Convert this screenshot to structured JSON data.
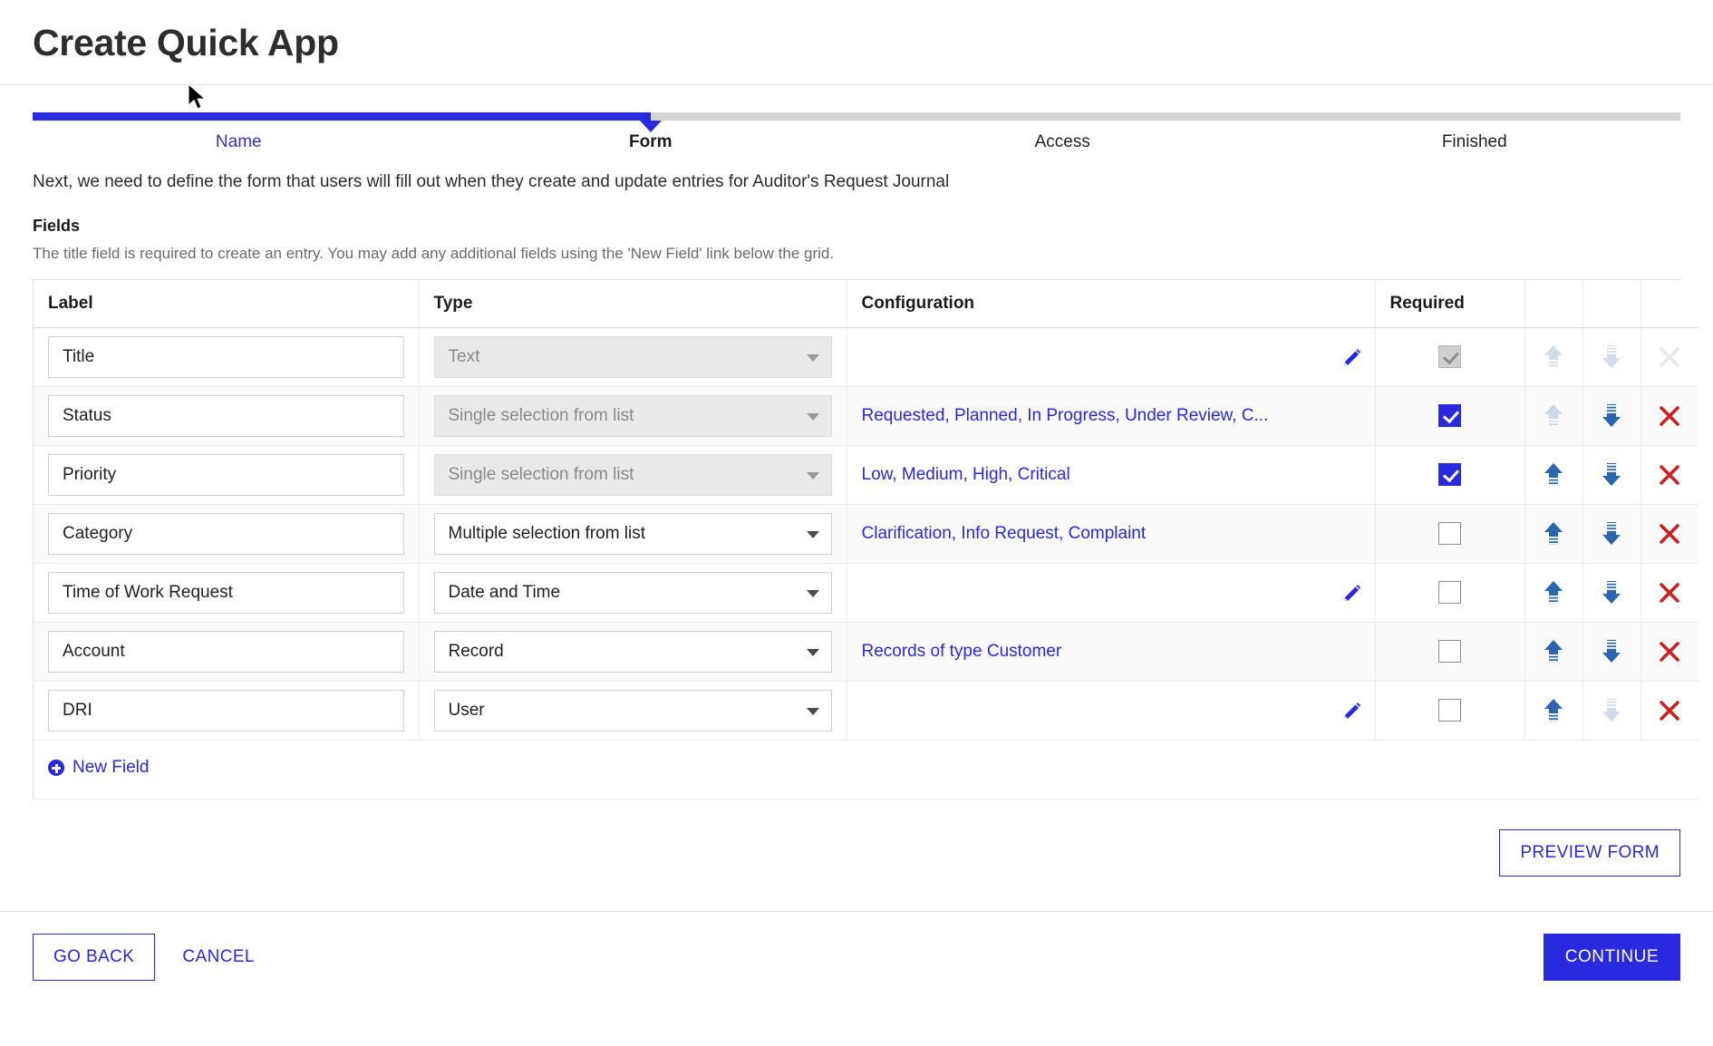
{
  "page": {
    "title": "Create Quick App",
    "intro": "Next, we need to define the form that users will fill out when they create and update entries for Auditor's Request Journal",
    "fields_heading": "Fields",
    "fields_subtext": "The title field is required to create an entry. You may add any additional fields using the 'New Field' link below the grid."
  },
  "stepper": {
    "fill_percent": 37.5,
    "accent_color": "#2929e0",
    "track_color": "#d4d4d4",
    "steps": [
      {
        "label": "Name",
        "state": "done"
      },
      {
        "label": "Form",
        "state": "current"
      },
      {
        "label": "Access",
        "state": "upcoming"
      },
      {
        "label": "Finished",
        "state": "upcoming"
      }
    ]
  },
  "grid": {
    "columns": [
      "Label",
      "Type",
      "Configuration",
      "Required",
      "",
      "",
      ""
    ],
    "rows": [
      {
        "label": "Title",
        "type": "Text",
        "type_disabled": true,
        "configuration": "",
        "has_pencil": true,
        "required": true,
        "required_disabled": true,
        "up_enabled": false,
        "down_enabled": false,
        "delete_enabled": false
      },
      {
        "label": "Status",
        "type": "Single selection from list",
        "type_disabled": true,
        "configuration": "Requested, Planned, In Progress, Under Review, C...",
        "has_pencil": false,
        "required": true,
        "required_disabled": false,
        "up_enabled": false,
        "down_enabled": true,
        "delete_enabled": true
      },
      {
        "label": "Priority",
        "type": "Single selection from list",
        "type_disabled": true,
        "configuration": "Low, Medium, High, Critical",
        "has_pencil": false,
        "required": true,
        "required_disabled": false,
        "up_enabled": true,
        "down_enabled": true,
        "delete_enabled": true
      },
      {
        "label": "Category",
        "type": "Multiple selection from list",
        "type_disabled": false,
        "configuration": "Clarification, Info Request, Complaint",
        "has_pencil": false,
        "required": false,
        "required_disabled": false,
        "up_enabled": true,
        "down_enabled": true,
        "delete_enabled": true
      },
      {
        "label": "Time of Work Request",
        "type": "Date and Time",
        "type_disabled": false,
        "configuration": "",
        "has_pencil": true,
        "required": false,
        "required_disabled": false,
        "up_enabled": true,
        "down_enabled": true,
        "delete_enabled": true
      },
      {
        "label": "Account",
        "type": "Record",
        "type_disabled": false,
        "configuration": "Records of type Customer",
        "has_pencil": false,
        "required": false,
        "required_disabled": false,
        "up_enabled": true,
        "down_enabled": true,
        "delete_enabled": true
      },
      {
        "label": "DRI",
        "type": "User",
        "type_disabled": false,
        "configuration": "",
        "has_pencil": true,
        "required": false,
        "required_disabled": false,
        "up_enabled": true,
        "down_enabled": false,
        "delete_enabled": true
      }
    ],
    "new_field_label": "New Field"
  },
  "actions": {
    "preview_form": "PREVIEW FORM",
    "go_back": "GO BACK",
    "cancel": "CANCEL",
    "continue": "CONTINUE"
  }
}
